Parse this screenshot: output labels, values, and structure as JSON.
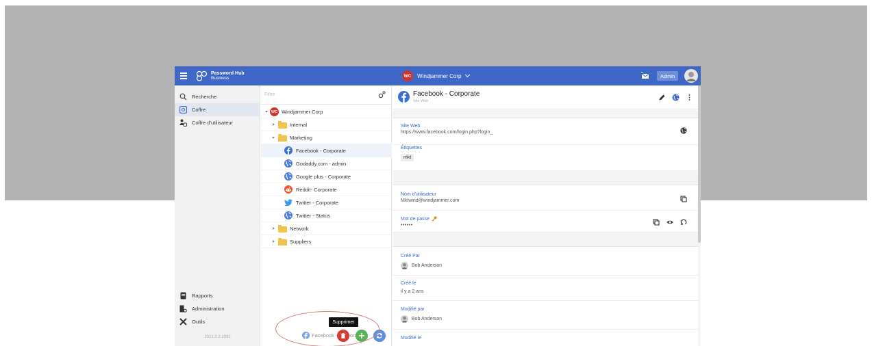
{
  "brand": {
    "line1": "Password Hub",
    "line2": "Business"
  },
  "header": {
    "org_badge": "WC",
    "org_name": "Windjammer Corp",
    "admin_label": "Admin"
  },
  "colors": {
    "accent": "#3e67c7",
    "delete": "#d33b33",
    "add": "#59b05a",
    "sync": "#5b8de5"
  },
  "leftnav": {
    "items": [
      {
        "label": "Recherche",
        "icon": "search-icon"
      },
      {
        "label": "Coffre",
        "icon": "vault-icon",
        "active": true
      },
      {
        "label": "Coffre d'utilisateur",
        "icon": "user-vault-icon"
      }
    ],
    "bottom_items": [
      {
        "label": "Rapports",
        "icon": "reports-icon"
      },
      {
        "label": "Administration",
        "icon": "admin-icon"
      },
      {
        "label": "Outils",
        "icon": "tools-icon"
      }
    ],
    "version": "2021.2.2.1092"
  },
  "tree": {
    "filter_placeholder": "Filtre",
    "root": "Windjammer Corp",
    "items": [
      {
        "label": "Internal",
        "type": "folder"
      },
      {
        "label": "Marketing",
        "type": "folder",
        "expanded": true
      },
      {
        "label": "Facebook - Corporate",
        "type": "facebook",
        "selected": true
      },
      {
        "label": "Godaddy.com - admin",
        "type": "web"
      },
      {
        "label": "Google plus - Corporate",
        "type": "web"
      },
      {
        "label": "Reddit- Corporate",
        "type": "reddit"
      },
      {
        "label": "Twitter - Corporate",
        "type": "twitter"
      },
      {
        "label": "Twitter - Status",
        "type": "web"
      },
      {
        "label": "Network",
        "type": "folder"
      },
      {
        "label": "Suppliers",
        "type": "folder"
      }
    ],
    "drag_ghost_label": "Facebook - Corporate",
    "tooltip": "Supprimer"
  },
  "detail": {
    "title": "Facebook - Corporate",
    "subtitle": "Site Web",
    "site_label": "Site Web",
    "site_value": "https://www.facebook.com/login.php?login_",
    "tags_label": "Étiquettes",
    "tag": "mkt",
    "username_label": "Nom d'utilisateur",
    "username_value": "Mktwind@windjammer.com",
    "password_label": "Mot de passe",
    "password_value": "••••••",
    "created_by_label": "Créé Par",
    "created_by_value": "Bob Anderson",
    "created_on_label": "Créé le",
    "created_on_value": "il y a 2 ans",
    "modified_by_label": "Modifié par",
    "modified_by_value": "Bob Anderson",
    "modified_on_label": "Modifié le"
  }
}
